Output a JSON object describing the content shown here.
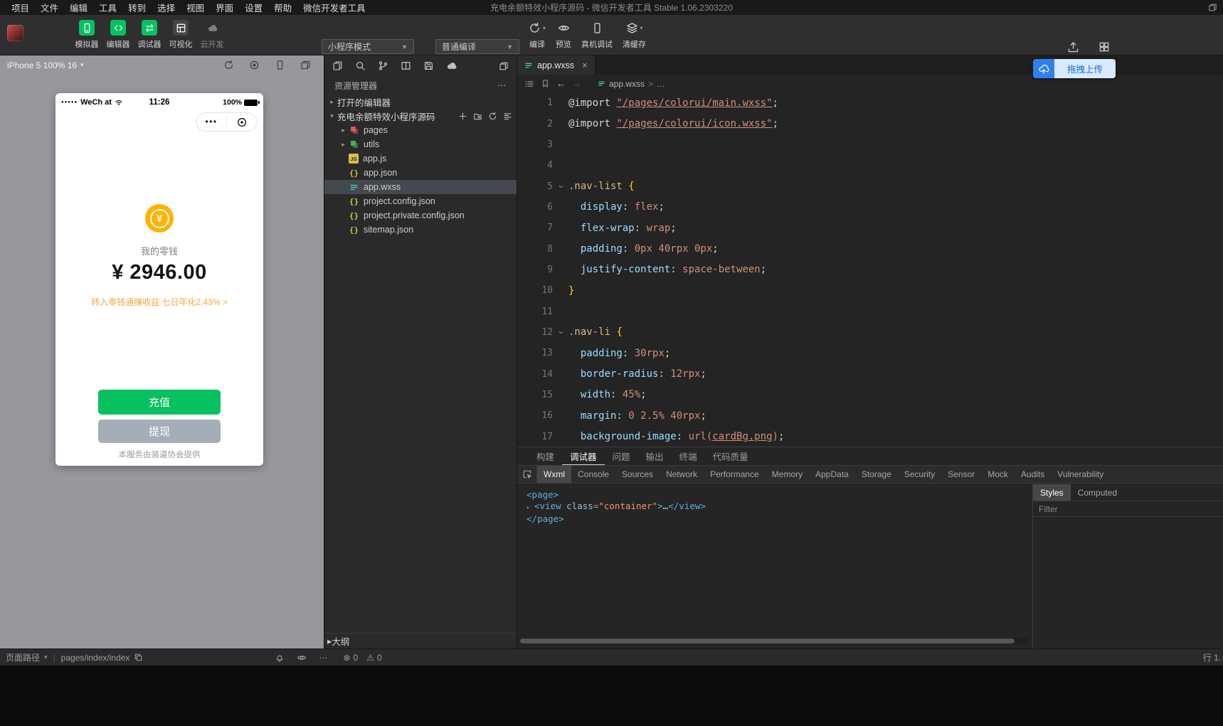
{
  "window": {
    "title": "充电余额特效小程序源码 - 微信开发者工具 Stable 1.06.2303220"
  },
  "menubar": {
    "items": [
      "项目",
      "文件",
      "编辑",
      "工具",
      "转到",
      "选择",
      "视图",
      "界面",
      "设置",
      "帮助",
      "微信开发者工具"
    ]
  },
  "toolbar": {
    "buttons": [
      {
        "name": "simulator",
        "label": "模拟器",
        "icon": "phone",
        "style": "green"
      },
      {
        "name": "editor",
        "label": "编辑器",
        "icon": "code",
        "style": "green"
      },
      {
        "name": "debugger",
        "label": "调试器",
        "icon": "swap",
        "style": "green"
      },
      {
        "name": "visualization",
        "label": "可视化",
        "icon": "grid",
        "style": "dark"
      },
      {
        "name": "cloud-dev",
        "label": "云开发",
        "icon": "cloud",
        "style": "muted"
      }
    ],
    "mode_select": {
      "value": "小程序模式"
    },
    "compile_select": {
      "value": "普通编译"
    },
    "actions": [
      {
        "name": "compile",
        "label": "编译",
        "icon": "refresh",
        "dropdown": true
      },
      {
        "name": "preview",
        "label": "预览",
        "icon": "eye",
        "dropdown": false
      },
      {
        "name": "remote-debug",
        "label": "真机调试",
        "icon": "device",
        "dropdown": false
      },
      {
        "name": "clear-cache",
        "label": "清缓存",
        "icon": "layers",
        "dropdown": true
      }
    ],
    "drag_upload_label": "拖拽上传"
  },
  "simulator": {
    "device_label": "iPhone 5 100% 16",
    "header_icons": [
      "refresh",
      "record",
      "device",
      "windows"
    ],
    "phone": {
      "carrier": "WeCh at",
      "time": "11:26",
      "battery_percent": "100%",
      "capsule_dots": "•••",
      "wallet_icon_symbol": "¥",
      "wallet_label": "我的零钱",
      "balance": "¥ 2946.00",
      "promo": "转入零钱通赚收益 七日年化2.43% >",
      "recharge_label": "充值",
      "withdraw_label": "提现",
      "footer": "本服务由装逼协会提供"
    }
  },
  "explorer": {
    "iconbar": [
      "files",
      "search",
      "branch",
      "split",
      "save",
      "cloud"
    ],
    "header": "资源管理器",
    "open_editors_label": "打开的编辑器",
    "project_name": "充电余额特效小程序源码",
    "project_actions": [
      "newfile",
      "folderplus",
      "refresh",
      "collapse"
    ],
    "outline_label": "大纲",
    "files": [
      {
        "name": "pages",
        "kind": "folder",
        "color": "#e0584b"
      },
      {
        "name": "utils",
        "kind": "folder",
        "color": "#4caf50"
      },
      {
        "name": "app.js",
        "kind": "js"
      },
      {
        "name": "app.json",
        "kind": "json"
      },
      {
        "name": "app.wxss",
        "kind": "wxss",
        "selected": true
      },
      {
        "name": "project.config.json",
        "kind": "json"
      },
      {
        "name": "project.private.config.json",
        "kind": "json"
      },
      {
        "name": "sitemap.json",
        "kind": "json"
      }
    ]
  },
  "editor": {
    "tab_label": "app.wxss",
    "breadcrumb_file": "app.wxss",
    "breadcrumb_more": "…",
    "code_lines": [
      {
        "n": 1,
        "tokens": [
          [
            "p",
            "@import "
          ],
          [
            "sl",
            "\"/pages/colorui/main.wxss\""
          ],
          [
            "p",
            ";"
          ]
        ]
      },
      {
        "n": 2,
        "tokens": [
          [
            "p",
            "@import "
          ],
          [
            "sl",
            "\"/pages/colorui/icon.wxss\""
          ],
          [
            "p",
            ";"
          ]
        ]
      },
      {
        "n": 3,
        "tokens": []
      },
      {
        "n": 4,
        "tokens": []
      },
      {
        "n": 5,
        "fold": true,
        "tokens": [
          [
            "sel",
            ".nav-list "
          ],
          [
            "br",
            "{"
          ]
        ]
      },
      {
        "n": 6,
        "tokens": [
          [
            "prop",
            "  display"
          ],
          [
            "p",
            ": "
          ],
          [
            "val",
            "flex"
          ],
          [
            "p",
            ";"
          ]
        ]
      },
      {
        "n": 7,
        "tokens": [
          [
            "prop",
            "  flex-wrap"
          ],
          [
            "p",
            ": "
          ],
          [
            "val",
            "wrap"
          ],
          [
            "p",
            ";"
          ]
        ]
      },
      {
        "n": 8,
        "tokens": [
          [
            "prop",
            "  padding"
          ],
          [
            "p",
            ": "
          ],
          [
            "val",
            "0px 40rpx 0px"
          ],
          [
            "p",
            ";"
          ]
        ]
      },
      {
        "n": 9,
        "tokens": [
          [
            "prop",
            "  justify-content"
          ],
          [
            "p",
            ": "
          ],
          [
            "val",
            "space-between"
          ],
          [
            "p",
            ";"
          ]
        ]
      },
      {
        "n": 10,
        "tokens": [
          [
            "br",
            "}"
          ]
        ]
      },
      {
        "n": 11,
        "tokens": []
      },
      {
        "n": 12,
        "fold": true,
        "tokens": [
          [
            "sel",
            ".nav-li "
          ],
          [
            "br",
            "{"
          ]
        ]
      },
      {
        "n": 13,
        "tokens": [
          [
            "prop",
            "  padding"
          ],
          [
            "p",
            ": "
          ],
          [
            "val",
            "30rpx"
          ],
          [
            "p",
            ";"
          ]
        ]
      },
      {
        "n": 14,
        "tokens": [
          [
            "prop",
            "  border-radius"
          ],
          [
            "p",
            ": "
          ],
          [
            "val",
            "12rpx"
          ],
          [
            "p",
            ";"
          ]
        ]
      },
      {
        "n": 15,
        "tokens": [
          [
            "prop",
            "  width"
          ],
          [
            "p",
            ": "
          ],
          [
            "val",
            "45%"
          ],
          [
            "p",
            ";"
          ]
        ]
      },
      {
        "n": 16,
        "tokens": [
          [
            "prop",
            "  margin"
          ],
          [
            "p",
            ": "
          ],
          [
            "val",
            "0 2.5% 40rpx"
          ],
          [
            "p",
            ";"
          ]
        ]
      },
      {
        "n": 17,
        "tokens": [
          [
            "prop",
            "  background-image"
          ],
          [
            "p",
            ": "
          ],
          [
            "val",
            "url("
          ],
          [
            "sl",
            "cardBg.png"
          ],
          [
            "val",
            ")"
          ],
          [
            "p",
            ";"
          ]
        ]
      }
    ]
  },
  "debugger": {
    "panel_tabs": [
      "构建",
      "调试器",
      "问题",
      "输出",
      "终端",
      "代码质量"
    ],
    "active_panel_tab": "调试器",
    "devtools_tabs": [
      "Wxml",
      "Console",
      "Sources",
      "Network",
      "Performance",
      "Memory",
      "AppData",
      "Storage",
      "Security",
      "Sensor",
      "Mock",
      "Audits",
      "Vulnerability"
    ],
    "active_devtools_tab": "Wxml",
    "wxml_lines": [
      {
        "arrow": false,
        "tokens": [
          [
            "ang",
            "<"
          ],
          [
            "tag",
            "page"
          ],
          [
            "ang",
            ">"
          ]
        ]
      },
      {
        "arrow": true,
        "tokens": [
          [
            "ang",
            "<"
          ],
          [
            "tag",
            "view"
          ],
          [
            "p",
            " "
          ],
          [
            "attr",
            "class"
          ],
          [
            "eq",
            "="
          ],
          [
            "val",
            "\"container\""
          ],
          [
            "ang",
            ">"
          ],
          [
            "dots",
            "…"
          ],
          [
            "ang",
            "</"
          ],
          [
            "tag",
            "view"
          ],
          [
            "ang",
            ">"
          ]
        ]
      },
      {
        "arrow": false,
        "tokens": [
          [
            "ang",
            "</"
          ],
          [
            "tag",
            "page"
          ],
          [
            "ang",
            ">"
          ]
        ]
      }
    ],
    "sidebar_tabs": [
      "Styles",
      "Computed"
    ],
    "active_sidebar_tab": "Styles",
    "filter_placeholder": "Filter"
  },
  "statusbar": {
    "page_path_label": "页面路径",
    "page_path": "pages/index/index",
    "error_count": "0",
    "warning_count": "0",
    "line_info": "行 1."
  },
  "colors": {
    "wechat_green": "#07c160",
    "accent_blue": "#2f80ed",
    "balance_orange": "#ffb300",
    "promo_orange": "#f6a742",
    "withdraw_gray": "#a5aeb8"
  }
}
